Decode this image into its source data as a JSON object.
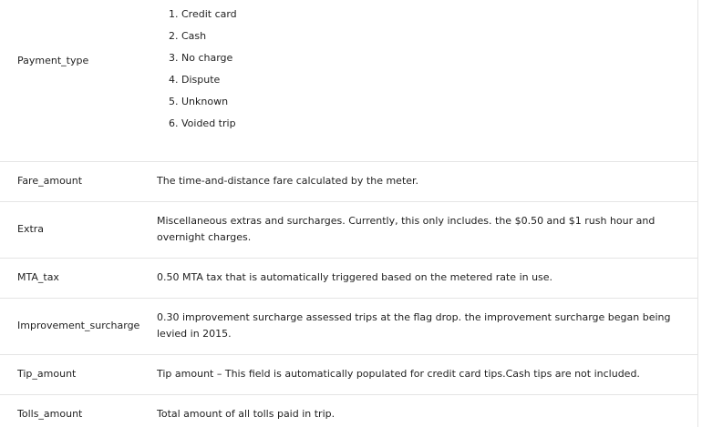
{
  "table": {
    "payment_type": {
      "name": "Payment_type",
      "options": [
        "1. Credit card",
        "2. Cash",
        "3. No charge",
        "4. Dispute",
        "5. Unknown",
        "6. Voided trip"
      ]
    },
    "rows": [
      {
        "name": "Fare_amount",
        "description": "The time-and-distance fare calculated by the meter."
      },
      {
        "name": "Extra",
        "description": "Miscellaneous extras and surcharges. Currently, this only includes. the $0.50 and $1 rush hour and overnight charges."
      },
      {
        "name": "MTA_tax",
        "description": "0.50 MTA tax that is automatically triggered based on the metered rate in use."
      },
      {
        "name": "Improvement_surcharge",
        "description": "0.30 improvement surcharge assessed trips at the flag drop. the improvement surcharge began being levied in 2015."
      },
      {
        "name": "Tip_amount",
        "description": "Tip amount – This field is automatically populated for credit card tips.Cash tips are not included."
      },
      {
        "name": "Tolls_amount",
        "description": "Total amount of all tolls paid in trip."
      }
    ]
  }
}
